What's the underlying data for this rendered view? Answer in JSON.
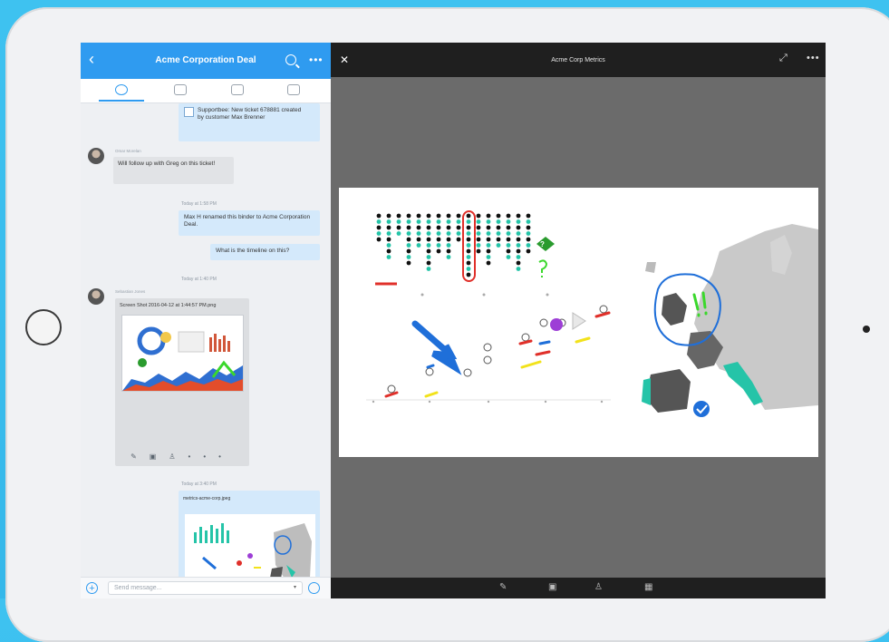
{
  "chat": {
    "title": "Acme Corporation Deal",
    "messages": {
      "ticket": "Supportbee: New ticket 678881 created by customer Max Brenner",
      "greg": "Will follow up with Greg on this ticket!",
      "greg_sender": "Omar Morelan",
      "ts1": "Today at 1:58 PM",
      "rename": "Max H renamed this binder to Acme Corporation Deal.",
      "timeline": "What is the timeline on this?",
      "ts2": "Today at 1:40 PM",
      "screenshot_sender": "Sebastian Jones",
      "screenshot_caption": "Screen Shot 2016-04-12 at 1:44:57 PM.png",
      "ts3": "Today at 3:40 PM",
      "image_caption": "metrics-acme-corp.jpeg"
    },
    "input_placeholder": "Send message..."
  },
  "viewer": {
    "title": "Acme Corp Metrics"
  },
  "colors": {
    "accent": "#2f9bf0",
    "teal": "#25c4a8",
    "annot_red": "#e0302a",
    "annot_blue": "#1f6fd9",
    "annot_green": "#3bd82c"
  },
  "icons": [
    "back-icon",
    "search-icon",
    "more-icon",
    "chat-tab-icon",
    "files-tab-icon",
    "todo-tab-icon",
    "apps-tab-icon",
    "add-icon",
    "mic-icon",
    "close-icon",
    "expand-icon",
    "pen-icon",
    "comment-icon",
    "stamp-icon",
    "grid-icon"
  ]
}
